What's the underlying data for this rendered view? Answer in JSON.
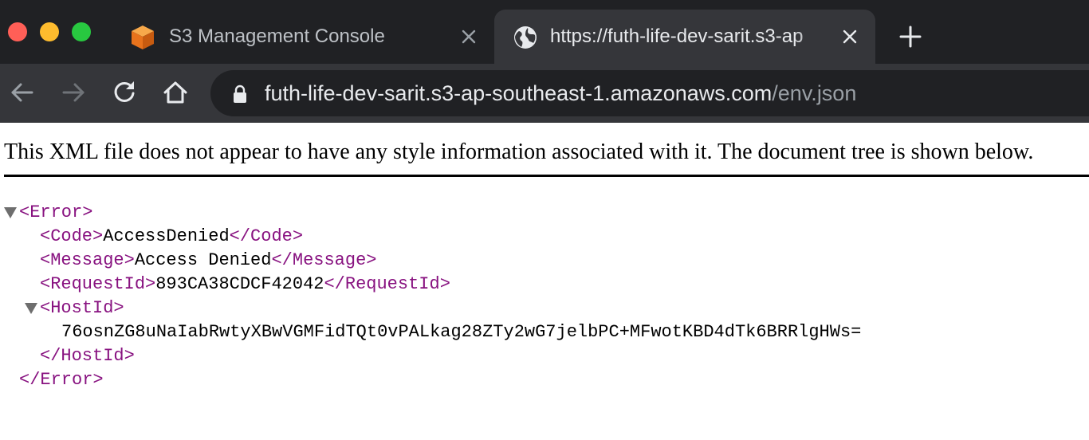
{
  "window": {
    "traffic_lights": [
      "close",
      "minimize",
      "zoom"
    ]
  },
  "tabs": [
    {
      "title": "S3 Management Console",
      "favicon": "aws-s3-icon",
      "active": false
    },
    {
      "title": "https://futh-life-dev-sarit.s3-ap",
      "favicon": "globe-icon",
      "active": true
    }
  ],
  "toolbar": {
    "url_host": "futh-life-dev-sarit.s3-ap-southeast-1.amazonaws.com",
    "url_path": "/env.json"
  },
  "xml_viewer": {
    "notice": "This XML file does not appear to have any style information associated with it. The document tree is shown below.",
    "error_open": "<Error>",
    "error_close": "</Error>",
    "code_open": "<Code>",
    "code_value": "AccessDenied",
    "code_close": "</Code>",
    "message_open": "<Message>",
    "message_value": "Access Denied",
    "message_close": "</Message>",
    "requestid_open": "<RequestId>",
    "requestid_value": "893CA38CDCF42042",
    "requestid_close": "</RequestId>",
    "hostid_open": "<HostId>",
    "hostid_value": "76osnZG8uNaIabRwtyXBwVGMFidTQt0vPALkag28ZTy2wG7jelbPC+MFwotKBD4dTk6BRRlgHWs=",
    "hostid_close": "</HostId>"
  },
  "colors": {
    "tag": "#881280",
    "chrome_bg": "#202124",
    "toolbar_bg": "#35363a"
  }
}
